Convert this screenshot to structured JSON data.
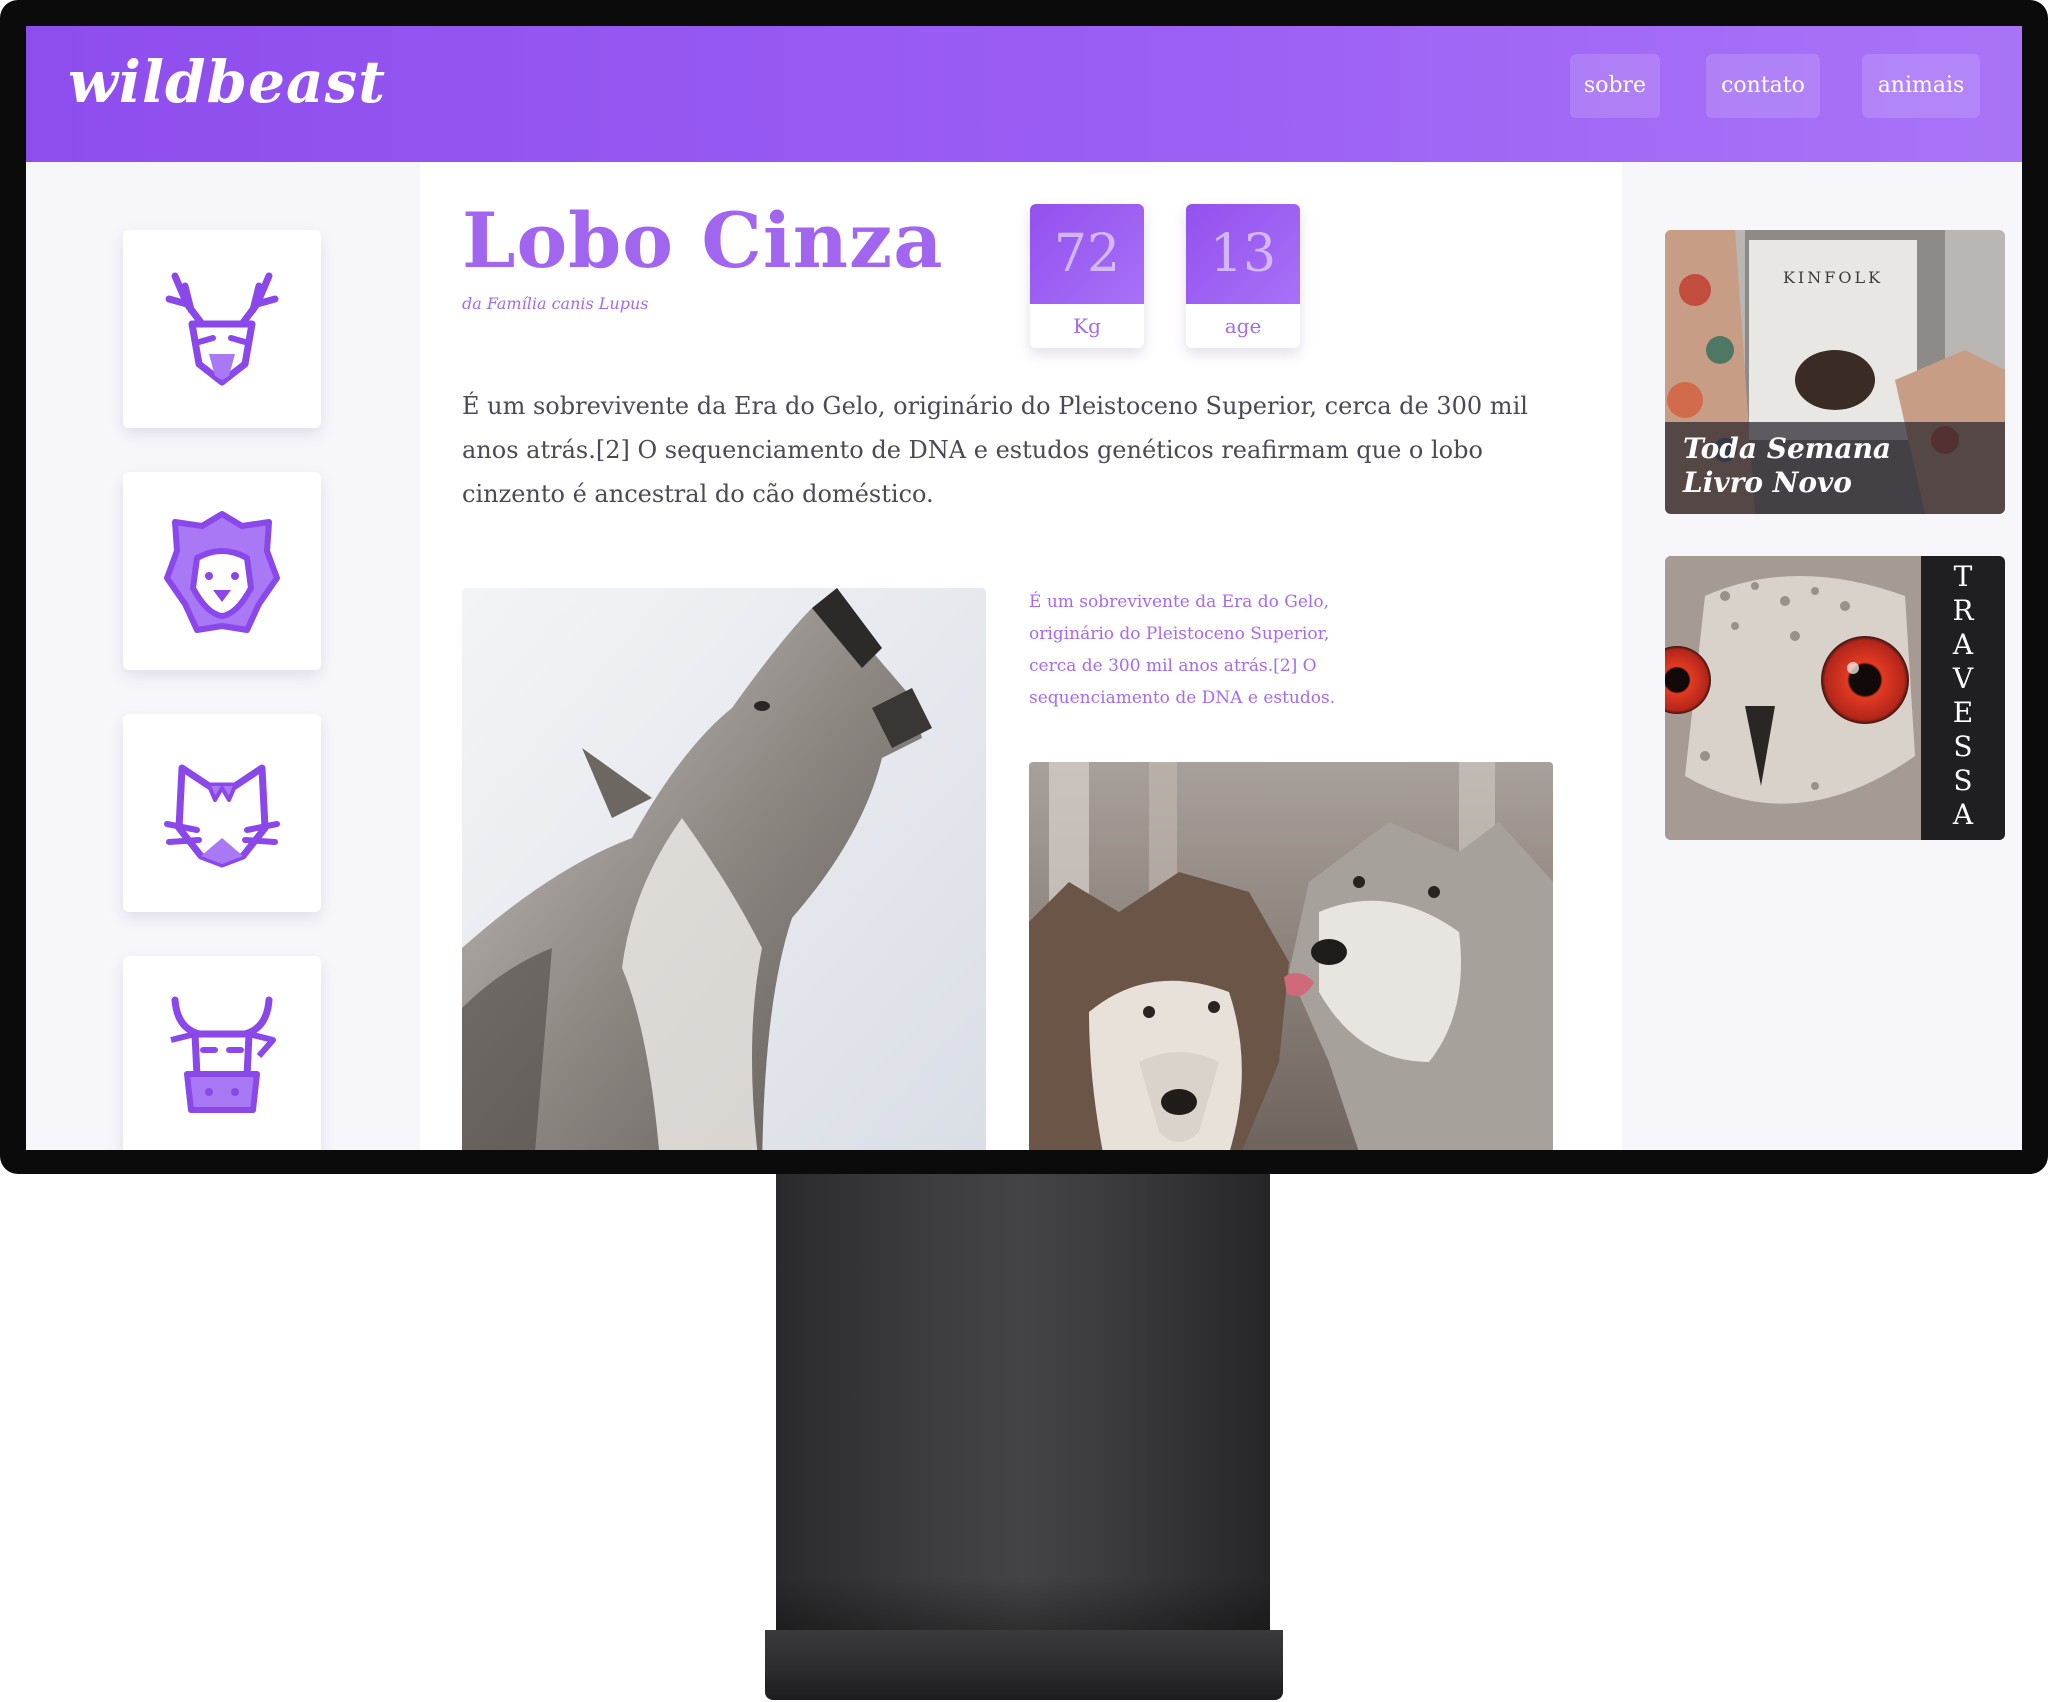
{
  "site": {
    "logo": "wildbeast",
    "nav": [
      {
        "label": "sobre"
      },
      {
        "label": "contato"
      },
      {
        "label": "animais"
      }
    ]
  },
  "sidebar": {
    "animals": [
      {
        "icon": "deer-icon"
      },
      {
        "icon": "lion-icon"
      },
      {
        "icon": "cat-icon"
      },
      {
        "icon": "bull-icon"
      }
    ]
  },
  "article": {
    "title": "Lobo Cinza",
    "subtitle": "da Família canis Lupus",
    "stats": [
      {
        "value": "72",
        "label": "Kg"
      },
      {
        "value": "13",
        "label": "age"
      }
    ],
    "body": "É um sobrevivente da Era do Gelo, originário do Pleistoceno Superior, cerca de 300 mil anos atrás.[2] O sequenciamento de DNA e estudos genéticos reafirmam que o lobo cinzento é ancestral do cão doméstico.",
    "caption": "É um sobrevivente da Era do Gelo, originário do Pleistoceno Superior, cerca de 300 mil anos atrás.[2] O sequenciamento de DNA e estudos."
  },
  "ads": {
    "kinfolk": {
      "magazine_title": "KINFOLK",
      "line1": "Toda Semana",
      "line2": "Livro Novo"
    },
    "owl": {
      "letters": [
        "T",
        "R",
        "A",
        "V",
        "E",
        "S",
        "S",
        "A"
      ]
    }
  },
  "colors": {
    "accent": "#a165f0",
    "header_start": "#8e4ded",
    "header_end": "#a874f7"
  }
}
